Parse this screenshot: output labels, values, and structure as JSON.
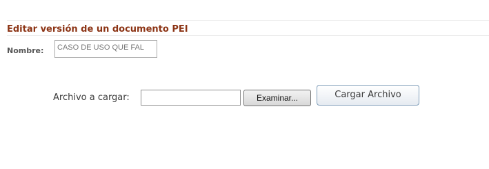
{
  "section": {
    "title": "Editar versión de un documento PEI"
  },
  "name_field": {
    "label": "Nombre:",
    "value": "CASO DE USO QUE FAL"
  },
  "upload": {
    "label": "Archivo a cargar:",
    "file_value": "",
    "browse_label": "Examinar...",
    "submit_label": "Cargar Archivo"
  }
}
